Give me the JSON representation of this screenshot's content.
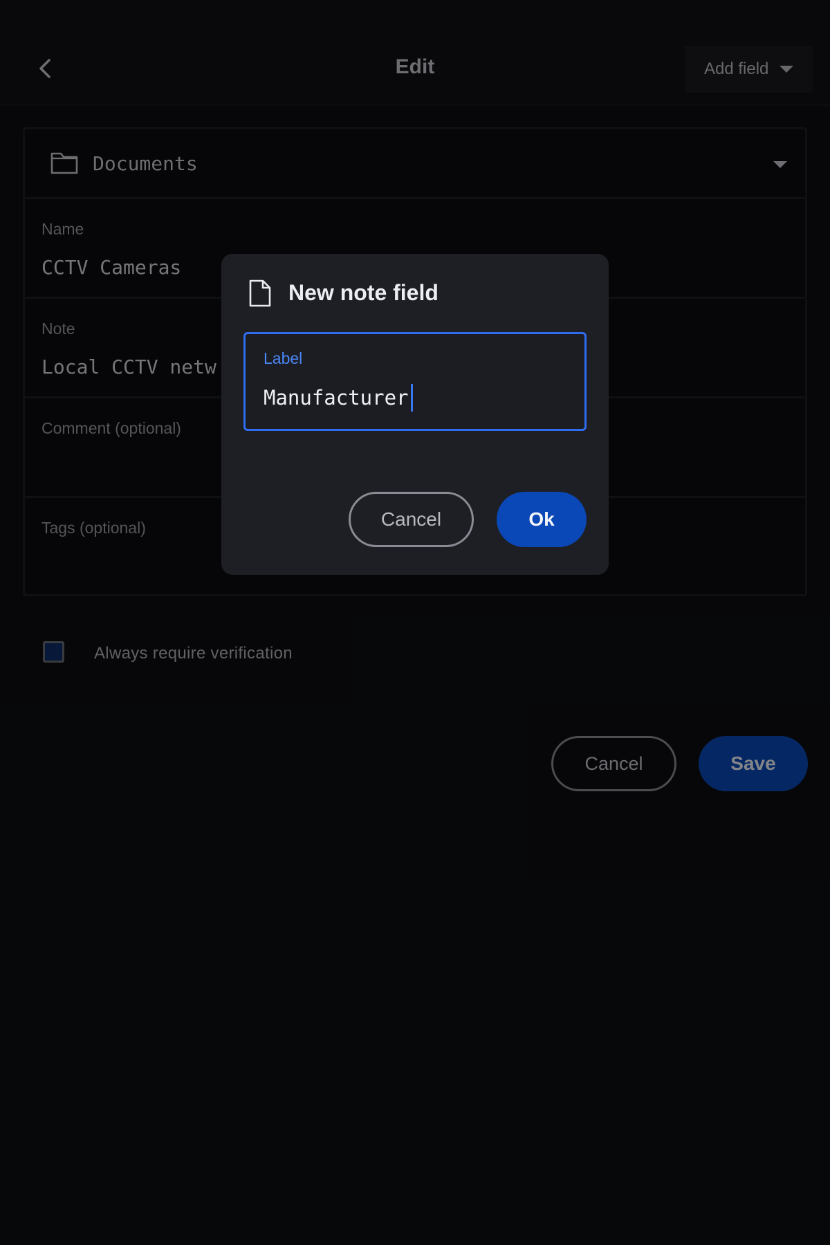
{
  "header": {
    "title": "Edit",
    "add_field_label": "Add field",
    "icons": {
      "back": "chevron-left-icon",
      "dropdown": "caret-down-icon"
    }
  },
  "form": {
    "folder": {
      "value": "Documents",
      "icon": "folder-icon"
    },
    "fields": {
      "name": {
        "label": "Name",
        "value": "CCTV Cameras"
      },
      "note": {
        "label": "Note",
        "value": "Local CCTV netw"
      },
      "comment": {
        "label": "Comment (optional)",
        "value": ""
      },
      "tags": {
        "label": "Tags (optional)",
        "value": ""
      }
    },
    "verification": {
      "label": "Always require verification",
      "checked": true
    },
    "actions": {
      "cancel_label": "Cancel",
      "save_label": "Save"
    }
  },
  "dialog": {
    "title": "New note field",
    "icon": "document-icon",
    "input": {
      "label": "Label",
      "value": "Manufacturer"
    },
    "actions": {
      "cancel_label": "Cancel",
      "ok_label": "Ok"
    }
  },
  "colors": {
    "background": "#0d0e11",
    "dialog_bg": "#1e1f24",
    "accent": "#2f6df0",
    "primary_button": "#0a49b8"
  }
}
